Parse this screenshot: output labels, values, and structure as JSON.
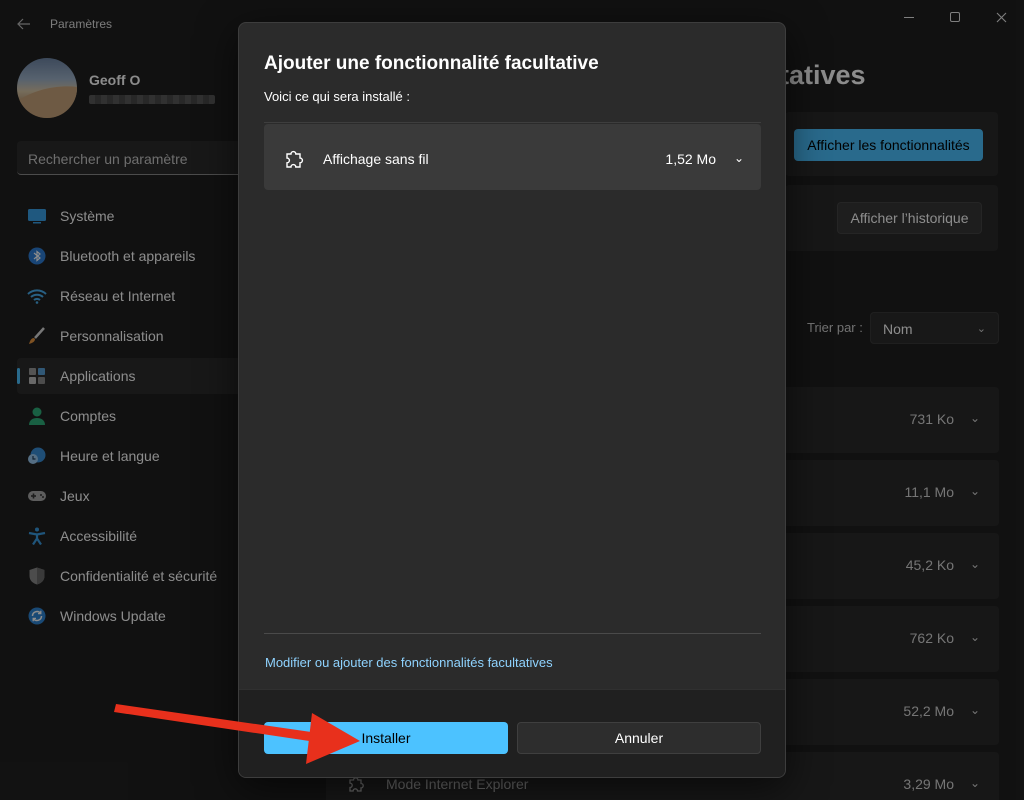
{
  "window": {
    "title": "Paramètres"
  },
  "profile": {
    "name": "Geoff O"
  },
  "search": {
    "placeholder": "Rechercher un paramètre"
  },
  "sidebar": {
    "items": [
      {
        "label": "Système",
        "icon": "system-icon"
      },
      {
        "label": "Bluetooth et appareils",
        "icon": "bluetooth-icon"
      },
      {
        "label": "Réseau et Internet",
        "icon": "wifi-icon"
      },
      {
        "label": "Personnalisation",
        "icon": "paintbrush-icon"
      },
      {
        "label": "Applications",
        "icon": "apps-icon",
        "selected": true
      },
      {
        "label": "Comptes",
        "icon": "account-icon"
      },
      {
        "label": "Heure et langue",
        "icon": "clock-globe-icon"
      },
      {
        "label": "Jeux",
        "icon": "gamepad-icon"
      },
      {
        "label": "Accessibilité",
        "icon": "accessibility-icon"
      },
      {
        "label": "Confidentialité et sécurité",
        "icon": "shield-icon"
      },
      {
        "label": "Windows Update",
        "icon": "update-icon"
      }
    ]
  },
  "main": {
    "title_visible_part": "tatives",
    "view_features_button": "Afficher les fonctionnalités",
    "view_history_button": "Afficher l’historique",
    "sort_label": "Trier par :",
    "sort_value": "Nom",
    "features": [
      {
        "name": "",
        "size": "731 Ko"
      },
      {
        "name": "",
        "size": "11,1 Mo"
      },
      {
        "name": "",
        "size": "45,2 Ko"
      },
      {
        "name": "",
        "size": "762 Ko"
      },
      {
        "name": "",
        "size": "52,2 Mo"
      },
      {
        "name": "Mode Internet Explorer",
        "size": "3,29 Mo"
      }
    ]
  },
  "dialog": {
    "title": "Ajouter une fonctionnalité facultative",
    "subtitle": "Voici ce qui sera installé :",
    "item": {
      "name": "Affichage sans fil",
      "size": "1,52 Mo"
    },
    "link": "Modifier ou ajouter des fonctionnalités facultatives",
    "install_button": "Installer",
    "cancel_button": "Annuler"
  },
  "colors": {
    "accent": "#4cc2ff",
    "annotation_arrow": "#e8301c"
  }
}
